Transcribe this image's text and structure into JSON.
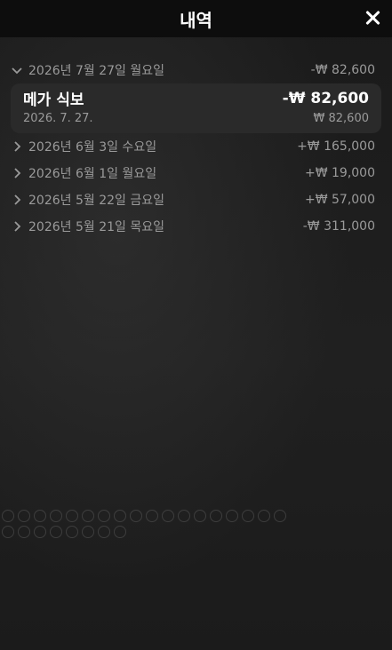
{
  "header": {
    "title": "내역"
  },
  "history": {
    "groups": [
      {
        "date": "2026년 7월 27일 월요일",
        "amount": "-₩ 82,600",
        "expanded": true,
        "transactions": [
          {
            "name": "메가 식보",
            "amount": "-₩ 82,600",
            "date": "2026. 7. 27.",
            "balance": "₩ 82,600"
          }
        ]
      },
      {
        "date": "2026년 6월 3일 수요일",
        "amount": "+₩ 165,000",
        "expanded": false
      },
      {
        "date": "2026년 6월 1일 월요일",
        "amount": "+₩ 19,000",
        "expanded": false
      },
      {
        "date": "2026년 5월 22일 금요일",
        "amount": "+₩ 57,000",
        "expanded": false
      },
      {
        "date": "2026년 5월 21일 목요일",
        "amount": "-₩ 311,000",
        "expanded": false
      }
    ]
  },
  "icons": {
    "close": "close-icon",
    "expanded": "chevron-down-icon",
    "collapsed": "chevron-right-icon"
  },
  "colors": {
    "background": "#141414",
    "header": "#0d0d0d",
    "card": "#2a2a2a",
    "muted_text": "#9a9a9a",
    "text": "#ffffff"
  }
}
